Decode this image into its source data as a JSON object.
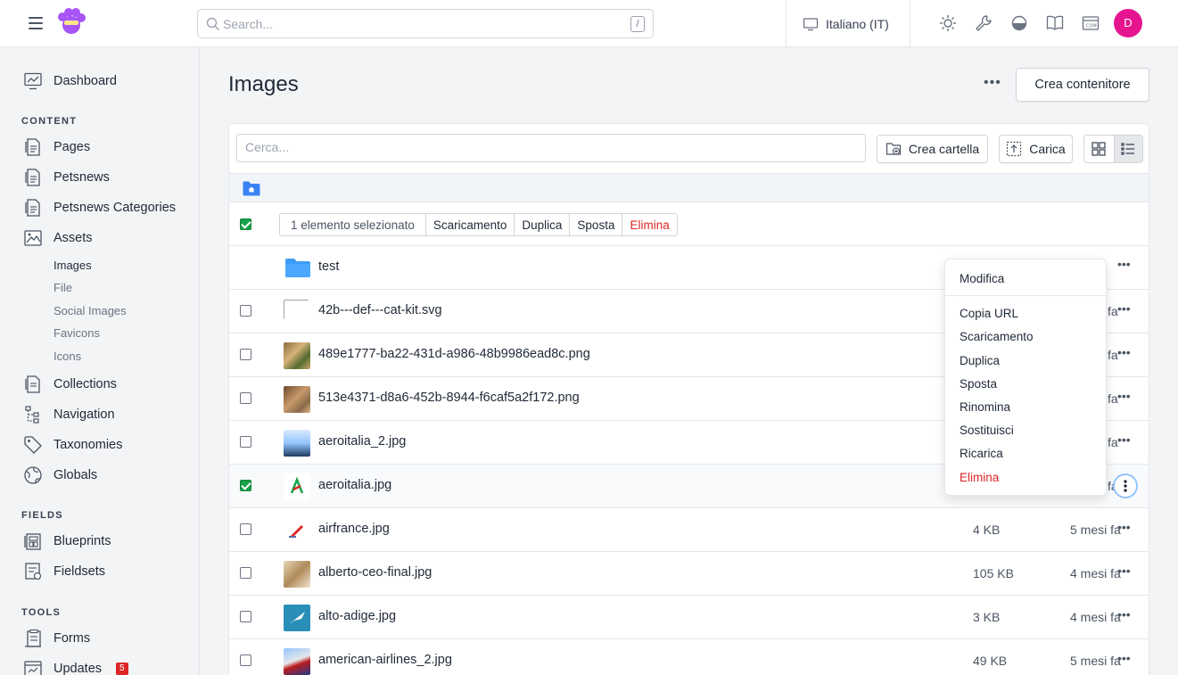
{
  "topbar": {
    "search_placeholder": "Search...",
    "search_shortcut": "/",
    "locale": "Italiano (IT)",
    "avatar_initial": "D",
    "avatar_color": "#e5148f"
  },
  "sidebar": {
    "dashboard": "Dashboard",
    "content_title": "CONTENT",
    "pages": "Pages",
    "petsnews": "Petsnews",
    "petsnews_categories": "Petsnews Categories",
    "assets": "Assets",
    "assets_sub": [
      "Images",
      "File",
      "Social Images",
      "Favicons",
      "Icons"
    ],
    "collections": "Collections",
    "navigation": "Navigation",
    "taxonomies": "Taxonomies",
    "globals": "Globals",
    "fields_title": "FIELDS",
    "blueprints": "Blueprints",
    "fieldsets": "Fieldsets",
    "tools_title": "TOOLS",
    "forms": "Forms",
    "updates": "Updates",
    "updates_badge": "5"
  },
  "main": {
    "title": "Images",
    "create_container": "Crea contenitore",
    "filter_placeholder": "Cerca...",
    "create_folder": "Crea cartella",
    "upload": "Carica",
    "bulk": {
      "count": "1 elemento selezionato",
      "download": "Scaricamento",
      "duplicate": "Duplica",
      "move": "Sposta",
      "delete": "Elimina"
    },
    "folder": "test",
    "rows": [
      {
        "name": "42b---def---cat-kit.svg",
        "size": "",
        "date": "i fa"
      },
      {
        "name": "489e1777-ba22-431d-a986-48b9986ead8c.png",
        "size": "",
        "date": "i fa"
      },
      {
        "name": "513e4371-d8a6-452b-8944-f6caf5a2f172.png",
        "size": "",
        "date": "i fa"
      },
      {
        "name": "aeroitalia_2.jpg",
        "size": "",
        "date": "i fa"
      },
      {
        "name": "aeroitalia.jpg",
        "size": "",
        "date": "i fa"
      },
      {
        "name": "airfrance.jpg",
        "size": "4 KB",
        "date": "5 mesi fa"
      },
      {
        "name": "alberto-ceo-final.jpg",
        "size": "105 KB",
        "date": "4 mesi fa"
      },
      {
        "name": "alto-adige.jpg",
        "size": "3 KB",
        "date": "4 mesi fa"
      },
      {
        "name": "american-airlines_2.jpg",
        "size": "49 KB",
        "date": "5 mesi fa"
      }
    ]
  },
  "dropdown": {
    "edit": "Modifica",
    "copy_url": "Copia URL",
    "download": "Scaricamento",
    "duplicate": "Duplica",
    "move": "Sposta",
    "rename": "Rinomina",
    "replace": "Sostituisci",
    "reload": "Ricarica",
    "delete": "Elimina"
  },
  "icons": [
    "hamburger-icon",
    "search-icon",
    "monitor-icon",
    "sun-icon",
    "wrench-icon",
    "contrast-icon",
    "book-icon",
    "dotcom-icon"
  ]
}
